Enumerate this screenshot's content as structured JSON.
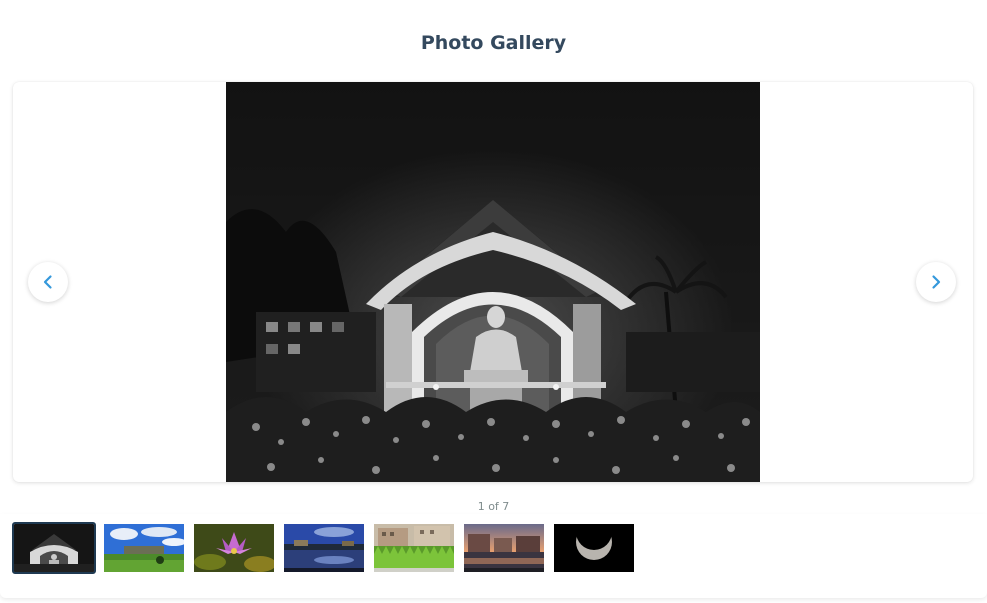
{
  "gallery": {
    "title": "Photo Gallery",
    "current_index": 1,
    "total": 7,
    "counter_text": "1 of 7",
    "main_photo_icon": "memorial-statue-night-photo",
    "prev_icon": "chevron-left-icon",
    "next_icon": "chevron-right-icon",
    "accent_color": "#3498db",
    "title_color": "#34495e",
    "thumbnails": [
      {
        "icon": "memorial-night-thumbnail",
        "active": true
      },
      {
        "icon": "field-blue-sky-thumbnail",
        "active": false
      },
      {
        "icon": "water-lily-thumbnail",
        "active": false
      },
      {
        "icon": "lake-reflection-thumbnail",
        "active": false
      },
      {
        "icon": "grass-building-thumbnail",
        "active": false
      },
      {
        "icon": "sunset-waterfront-thumbnail",
        "active": false
      },
      {
        "icon": "crescent-moon-thumbnail",
        "active": false
      }
    ]
  }
}
